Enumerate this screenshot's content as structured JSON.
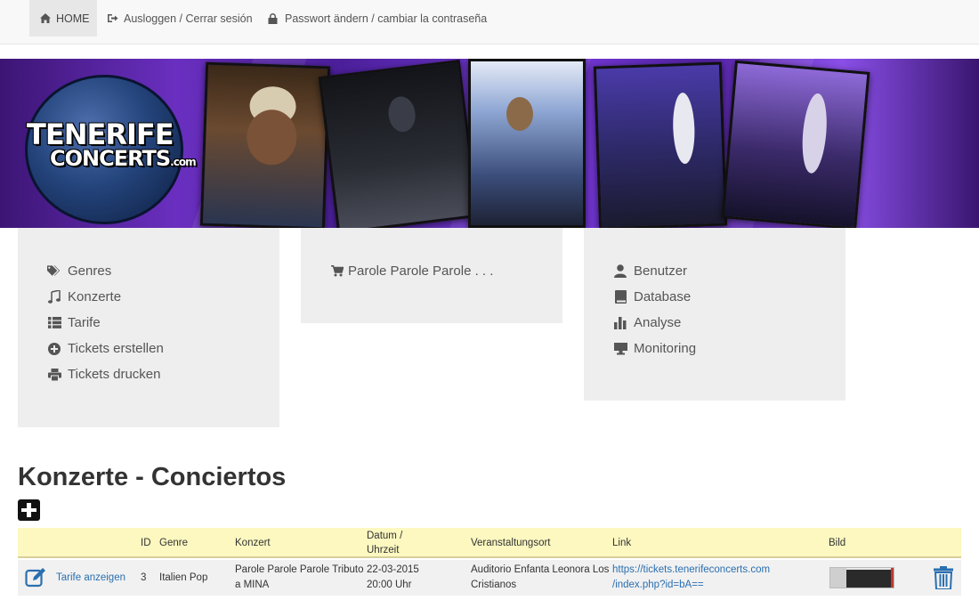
{
  "nav": {
    "home": "HOME",
    "logout": "Ausloggen / Cerrar sesión",
    "password": "Passwort ändern / cambiar la contraseña"
  },
  "banner": {
    "logo_line1": "TENERIFE",
    "logo_line2": "CONCERTS",
    "logo_suffix": ".com"
  },
  "menu_left": [
    {
      "label": "Genres",
      "icon": "tags-icon"
    },
    {
      "label": "Konzerte",
      "icon": "music-note-icon"
    },
    {
      "label": "Tarife",
      "icon": "list-icon"
    },
    {
      "label": "Tickets erstellen",
      "icon": "plus-circle-icon"
    },
    {
      "label": "Tickets drucken",
      "icon": "print-icon"
    }
  ],
  "menu_middle": [
    {
      "label": "Parole Parole Parole . . .",
      "icon": "cart-icon"
    }
  ],
  "menu_right": [
    {
      "label": "Benutzer",
      "icon": "user-icon"
    },
    {
      "label": "Database",
      "icon": "book-icon"
    },
    {
      "label": "Analyse",
      "icon": "bar-chart-icon"
    },
    {
      "label": "Monitoring",
      "icon": "monitor-icon"
    }
  ],
  "page_title": "Konzerte - Conciertos",
  "table": {
    "headers": {
      "id": "ID",
      "genre": "Genre",
      "konzert": "Konzert",
      "datum_1": "Datum /",
      "datum_2": "Uhrzeit",
      "ort": "Veranstaltungsort",
      "link": "Link",
      "bild": "Bild"
    },
    "rows": [
      {
        "action": "Tarife anzeigen",
        "id": "3",
        "genre": "Italien Pop",
        "konzert_1": "Parole Parole Parole Tributo",
        "konzert_2": "a MINA",
        "datum_1": "22-03-2015",
        "datum_2": "20:00 Uhr",
        "ort_1": "Auditorio Enfanta Leonora Los",
        "ort_2": "Cristianos",
        "link_1": "https://tickets.tenerifeconcerts.com",
        "link_2": "/index.php?id=bA=="
      }
    ]
  },
  "colors": {
    "accent": "#2a6fb0",
    "header_bg": "#fcf8c0",
    "box_bg": "#eeeeee"
  }
}
